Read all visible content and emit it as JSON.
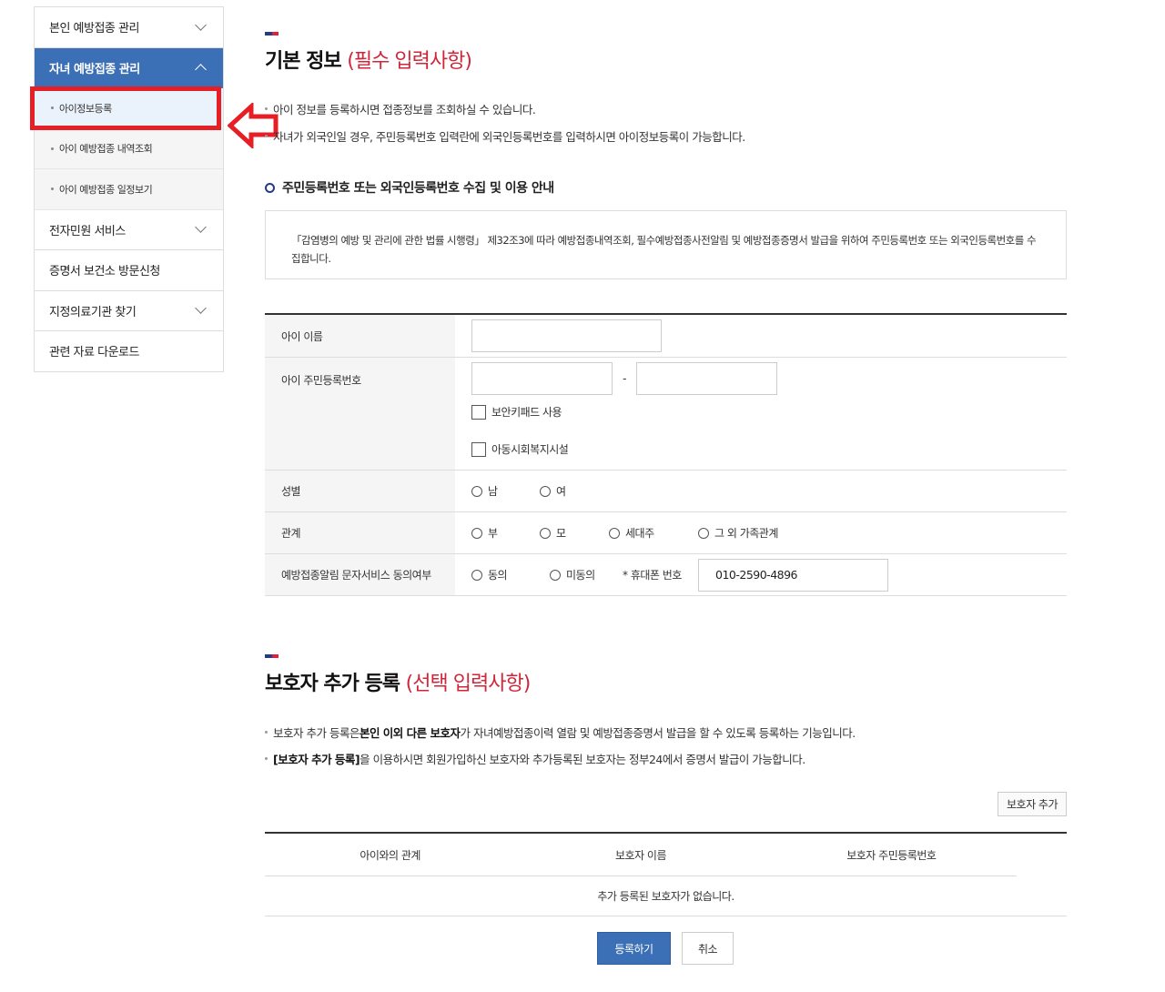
{
  "sidebar": {
    "items": [
      {
        "label": "본인 예방접종 관리"
      },
      {
        "label": "자녀 예방접종 관리"
      },
      {
        "label": "전자민원 서비스"
      },
      {
        "label": "증명서 보건소 방문신청"
      },
      {
        "label": "지정의료기관 찾기"
      },
      {
        "label": "관련 자료 다운로드"
      }
    ],
    "sub_items": [
      {
        "label": "아이정보등록"
      },
      {
        "label": "아이 예방접종 내역조회"
      },
      {
        "label": "아이 예방접종 일정보기"
      }
    ]
  },
  "basic": {
    "title": "기본 정보",
    "subtitle": "(필수 입력사항)",
    "bullets": [
      "아이 정보를 등록하시면 접종정보를 조회하실 수 있습니다.",
      "자녀가 외국인일 경우, 주민등록번호 입력란에 외국인등록번호를 입력하시면 아이정보등록이 가능합니다."
    ],
    "notice_title": "주민등록번호 또는 외국인등록번호 수집 및 이용 안내",
    "notice_text": "「감염병의 예방 및 관리에 관한 법률 시행령」 제32조3에 따라 예방접종내역조회, 필수예방접종사전알림 및 예방접종증명서 발급을 위하여 주민등록번호 또는 외국인등록번호를 수집합니다."
  },
  "form": {
    "child_name_label": "아이 이름",
    "child_rrn_label": "아이 주민등록번호",
    "rrn_separator": "-",
    "secure_keypad_label": "보안키패드 사용",
    "welfare_label": "아동시회복지시설",
    "gender_label": "성별",
    "gender_male": "남",
    "gender_female": "여",
    "relation_label": "관계",
    "relation_options": [
      "부",
      "모",
      "세대주",
      "그 외 가족관계"
    ],
    "sms_label": "예방접종알림 문자서비스 동의여부",
    "sms_agree": "동의",
    "sms_disagree": "미동의",
    "phone_label": "* 휴대폰 번호",
    "phone_value": "010-2590-4896"
  },
  "guardian": {
    "title": "보호자 추가 등록",
    "subtitle": "(선택 입력사항)",
    "bullet1_pre": "보호자 추가 등록은 ",
    "bullet1_bold": "본인 이외 다른 보호자",
    "bullet1_post": "가 자녀예방접종이력 열람 및 예방접종증명서 발급을 할 수 있도록 등록하는 기능입니다.",
    "bullet2_bold": "[보호자 추가 등록]",
    "bullet2_post": "을 이용하시면 회원가입하신 보호자와 추가등록된 보호자는 정부24에서 증명서 발급이 가능합니다.",
    "add_button": "보호자 추가",
    "columns": [
      "아이와의 관계",
      "보호자 이름",
      "보호자 주민등록번호"
    ],
    "empty_text": "추가 등록된 보호자가 없습니다."
  },
  "actions": {
    "submit": "등록하기",
    "cancel": "취소"
  },
  "colors": {
    "accent": "#3b6fb6",
    "highlight": "#e51f25",
    "subtitle": "#d0263a"
  }
}
